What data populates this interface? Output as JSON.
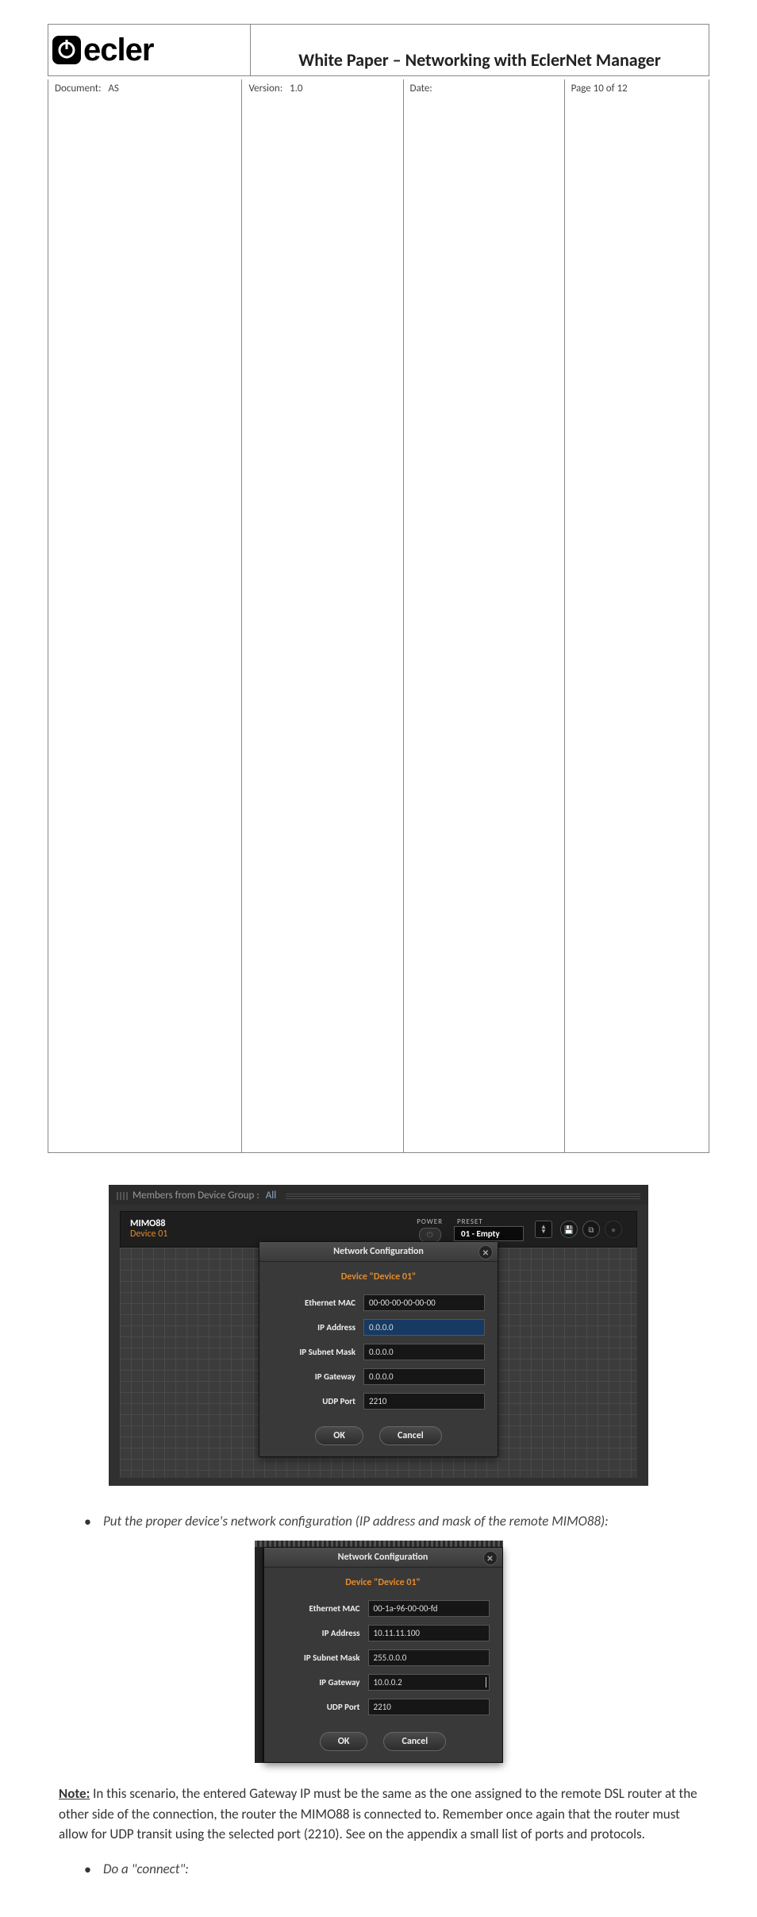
{
  "header": {
    "logo_text": "ecler",
    "title": "White Paper – Networking with EclerNet Manager",
    "document_label": "Document:",
    "document_value": "AS",
    "version_label": "Version:",
    "version_value": "1.0",
    "date_label": "Date:",
    "date_value": "",
    "page_label": "Page 10 of 12"
  },
  "shot1": {
    "group_label": "Members from Device Group :",
    "group_value": "All",
    "device_model": "MIMO88",
    "device_name": "Device 01",
    "power_label": "POWER",
    "preset_label": "PRESET",
    "preset_value": "01 - Empty"
  },
  "dlg1": {
    "title": "Network Configuration",
    "subtitle": "Device \"Device 01\"",
    "rows": {
      "mac_k": "Ethernet MAC",
      "mac_v": "00-00-00-00-00-00",
      "ip_k": "IP Address",
      "ip_v": "0.0.0.0",
      "mask_k": "IP Subnet Mask",
      "mask_v": "0.0.0.0",
      "gw_k": "IP Gateway",
      "gw_v": "0.0.0.0",
      "port_k": "UDP Port",
      "port_v": "2210"
    },
    "ok": "OK",
    "cancel": "Cancel"
  },
  "bullet1": "Put the proper device's network configuration (IP address and mask of the remote MIMO88):",
  "dlg2": {
    "title": "Network Configuration",
    "subtitle": "Device \"Device 01\"",
    "rows": {
      "mac_k": "Ethernet MAC",
      "mac_v": "00-1a-96-00-00-fd",
      "ip_k": "IP Address",
      "ip_v": "10.11.11.100",
      "mask_k": "IP Subnet Mask",
      "mask_v": "255.0.0.0",
      "gw_k": "IP Gateway",
      "gw_v": "10.0.0.2",
      "port_k": "UDP Port",
      "port_v": "2210"
    },
    "ok": "OK",
    "cancel": "Cancel"
  },
  "note": {
    "label": "Note:",
    "text": " In this scenario, the entered Gateway IP must be the same as the one assigned to the remote DSL router at the other side of the connection, the router the MIMO88 is connected to. Remember once again that the router must allow for UDP transit using the selected port (2210). See on the appendix a small list of ports and protocols."
  },
  "bullet2": "Do a \"connect\":"
}
